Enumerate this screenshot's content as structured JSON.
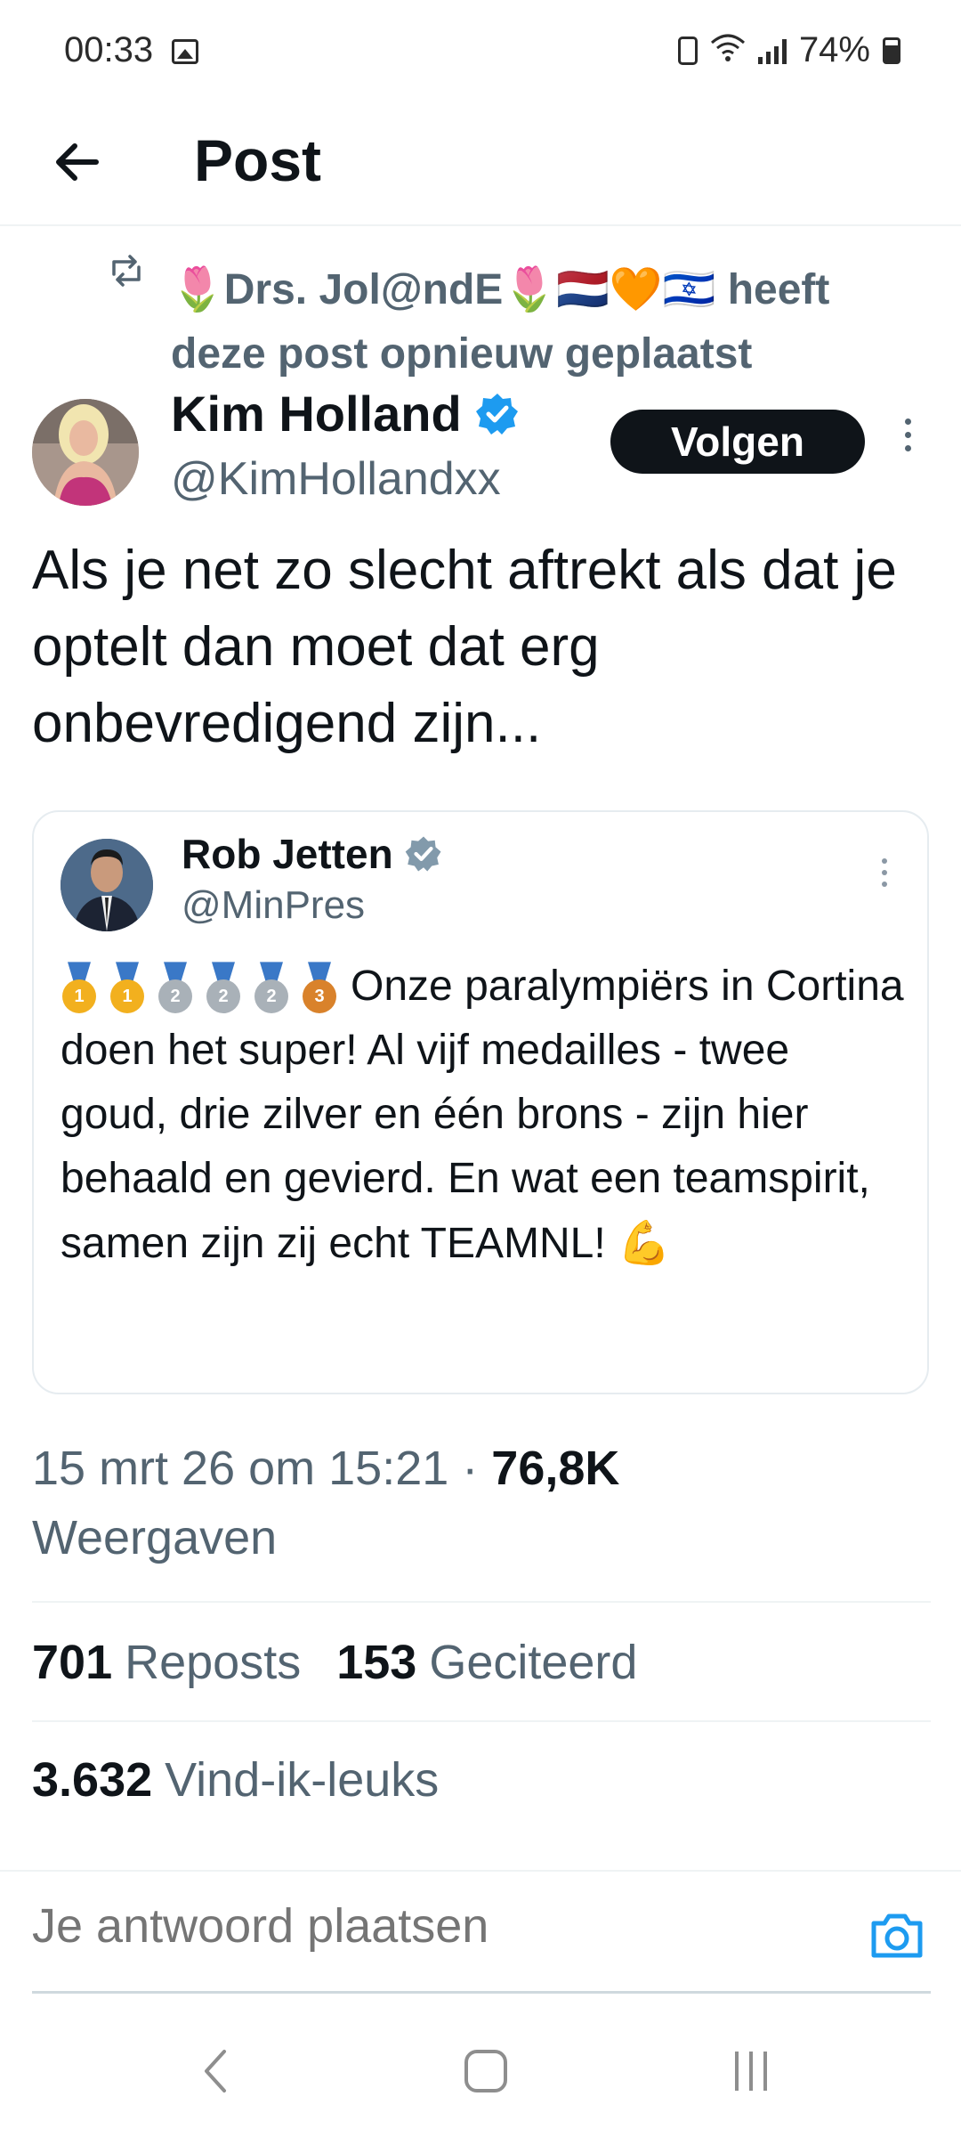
{
  "status_bar": {
    "time": "00:33",
    "battery": "74%"
  },
  "header": {
    "title": "Post"
  },
  "repost": {
    "text_suffix": "heeft deze post opnieuw geplaatst",
    "name": "🌷Drs. Jol@ndE🌷🇳🇱🧡🇮🇱"
  },
  "author": {
    "name": "Kim Holland",
    "handle": "@KimHollandxx",
    "follow_label": "Volgen"
  },
  "post": {
    "text": "Als je net zo slecht aftrekt als dat je optelt dan moet dat erg onbevredigend zijn..."
  },
  "quote": {
    "name": "Rob Jetten",
    "handle": "@MinPres",
    "text": "Onze paralympiërs in Cortina doen het super! Al vijf medailles - twee goud, drie zilver en één brons - zijn hier behaald en gevierd. En wat een teamspirit, samen zijn zij echt TEAMNL!",
    "medals": [
      {
        "place": "1",
        "color": "#f2b01e"
      },
      {
        "place": "1",
        "color": "#f2b01e"
      },
      {
        "place": "2",
        "color": "#a9b1b8"
      },
      {
        "place": "2",
        "color": "#a9b1b8"
      },
      {
        "place": "2",
        "color": "#a9b1b8"
      },
      {
        "place": "3",
        "color": "#d9822b"
      }
    ],
    "end_emoji": "💪"
  },
  "meta": {
    "timestamp": "15 mrt 26 om 15:21",
    "separator": "·",
    "views_count": "76,8K",
    "views_label": "Weergaven"
  },
  "stats": {
    "reposts_count": "701",
    "reposts_label": "Reposts",
    "quotes_count": "153",
    "quotes_label": "Geciteerd",
    "likes_count": "3.632",
    "likes_label": "Vind-ik-leuks"
  },
  "reply": {
    "placeholder": "Je antwoord plaatsen"
  },
  "colors": {
    "accent": "#1d9bf0",
    "text": "#0f1419",
    "muted": "#536471"
  }
}
